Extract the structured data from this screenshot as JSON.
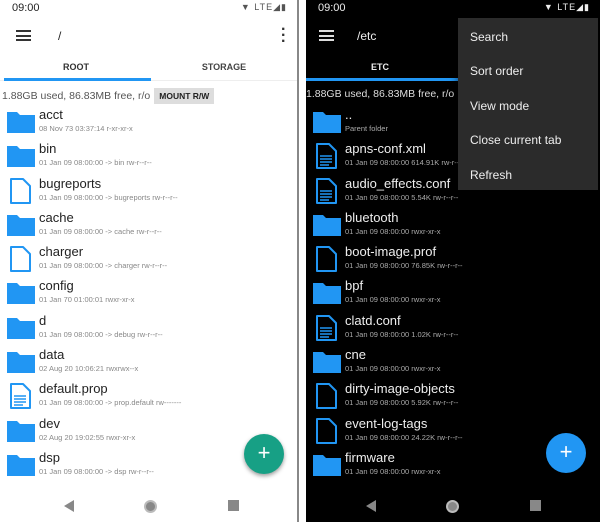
{
  "left": {
    "status": {
      "time": "09:00",
      "signal": "▼ LTE◢▮"
    },
    "path": "/",
    "tabs": [
      "ROOT",
      "STORAGE"
    ],
    "info": "1.88GB used, 86.83MB free, r/o",
    "mount": "MOUNT R/W",
    "files": [
      {
        "type": "folder",
        "name": "acct",
        "meta": "08 Nov 73 03:37:14   r-xr-xr-x"
      },
      {
        "type": "folder",
        "name": "bin",
        "meta": "01 Jan 09 08:00:00  -> bin  rw-r--r--"
      },
      {
        "type": "file",
        "name": "bugreports",
        "meta": "01 Jan 09 08:00:00  -> bugreports  rw-r--r--"
      },
      {
        "type": "folder",
        "name": "cache",
        "meta": "01 Jan 09 08:00:00  -> cache  rw-r--r--"
      },
      {
        "type": "file",
        "name": "charger",
        "meta": "01 Jan 09 08:00:00  -> charger  rw-r--r--"
      },
      {
        "type": "folder",
        "name": "config",
        "meta": "01 Jan 70 01:00:01    rwxr-xr-x"
      },
      {
        "type": "folder",
        "name": "d",
        "meta": "01 Jan 09 08:00:00  -> debug  rw-r--r--"
      },
      {
        "type": "folder",
        "name": "data",
        "meta": "02 Aug 20 10:06:21    rwxrwx--x"
      },
      {
        "type": "text",
        "name": "default.prop",
        "meta": "01 Jan 09 08:00:00  -> prop.default  rw-------"
      },
      {
        "type": "folder",
        "name": "dev",
        "meta": "02 Aug 20 19:02:55    rwxr-xr-x"
      },
      {
        "type": "folder",
        "name": "dsp",
        "meta": "01 Jan 09 08:00:00  -> dsp  rw-r--r--"
      }
    ],
    "fab": "+"
  },
  "right": {
    "status": {
      "time": "09:00",
      "signal": "▼ LTE◢▮"
    },
    "path": "/etc",
    "tabs": [
      "ETC"
    ],
    "info": "1.88GB used, 86.83MB free, r/o",
    "files": [
      {
        "type": "folder",
        "name": "..",
        "meta": "Parent folder"
      },
      {
        "type": "text",
        "name": "apns-conf.xml",
        "meta": "01 Jan 09 08:00:00  614.91K  rw-r--r--"
      },
      {
        "type": "text",
        "name": "audio_effects.conf",
        "meta": "01 Jan 09 08:00:00  5.54K  rw-r--r--"
      },
      {
        "type": "folder",
        "name": "bluetooth",
        "meta": "01 Jan 09 08:00:00    rwxr-xr-x"
      },
      {
        "type": "file",
        "name": "boot-image.prof",
        "meta": "01 Jan 09 08:00:00  76.85K  rw-r--r--"
      },
      {
        "type": "folder",
        "name": "bpf",
        "meta": "01 Jan 09 08:00:00    rwxr-xr-x"
      },
      {
        "type": "text",
        "name": "clatd.conf",
        "meta": "01 Jan 09 08:00:00  1.02K  rw-r--r--"
      },
      {
        "type": "folder",
        "name": "cne",
        "meta": "01 Jan 09 08:00:00    rwxr-xr-x"
      },
      {
        "type": "file",
        "name": "dirty-image-objects",
        "meta": "01 Jan 09 08:00:00  5.92K  rw-r--r--"
      },
      {
        "type": "file",
        "name": "event-log-tags",
        "meta": "01 Jan 09 08:00:00  24.22K  rw-r--r--"
      },
      {
        "type": "folder",
        "name": "firmware",
        "meta": "01 Jan 09 08:00:00    rwxr-xr-x"
      }
    ],
    "menu": [
      "Search",
      "Sort order",
      "View mode",
      "Close current tab",
      "Refresh"
    ],
    "fab": "+"
  },
  "colors": {
    "accent": "#2196f3",
    "fab_light": "#17a085",
    "fab_dark": "#2196f3"
  }
}
